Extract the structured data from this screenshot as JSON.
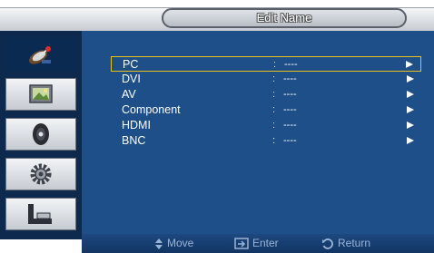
{
  "header": {
    "title": "Edit Name"
  },
  "sidebar": {
    "items": [
      {
        "icon": "satellite-dish-icon",
        "active": true
      },
      {
        "icon": "picture-icon",
        "active": false
      },
      {
        "icon": "sound-icon",
        "active": false
      },
      {
        "icon": "setup-gear-icon",
        "active": false
      },
      {
        "icon": "multi-screen-icon",
        "active": false
      }
    ]
  },
  "menu": {
    "rows": [
      {
        "label": "PC",
        "value": "----",
        "selected": true
      },
      {
        "label": "DVI",
        "value": "----",
        "selected": false
      },
      {
        "label": "AV",
        "value": "----",
        "selected": false
      },
      {
        "label": "Component",
        "value": "----",
        "selected": false
      },
      {
        "label": "HDMI",
        "value": "----",
        "selected": false
      },
      {
        "label": "BNC",
        "value": "----",
        "selected": false
      }
    ],
    "separator": ":"
  },
  "help": {
    "move": "Move",
    "enter": "Enter",
    "return": "Return"
  },
  "colors": {
    "panel": "#1e4f89",
    "sidebar": "#0d2a4e",
    "highlight": "#e8c21a"
  }
}
